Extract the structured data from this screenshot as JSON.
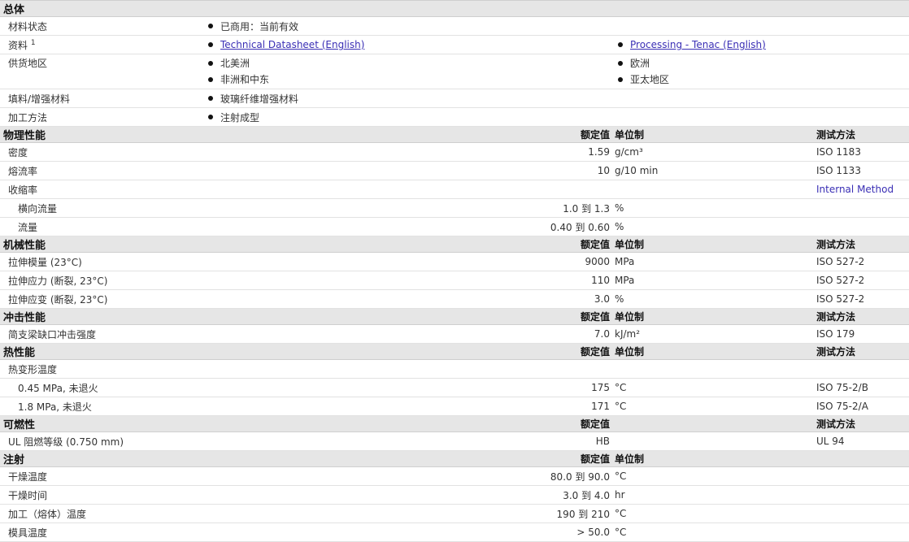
{
  "general": {
    "title": "总体",
    "status": {
      "label": "材料状态",
      "value": "已商用：当前有效"
    },
    "resources": {
      "label": "资料",
      "sup": "1",
      "links": [
        "Technical Datasheet (English)",
        "Processing - Tenac (English)"
      ]
    },
    "regions": {
      "label": "供货地区",
      "col1": [
        "北美洲",
        "非洲和中东"
      ],
      "col2": [
        "欧洲",
        "亚太地区"
      ]
    },
    "filler": {
      "label": "填料/增强材料",
      "value": "玻璃纤维增强材料"
    },
    "method": {
      "label": "加工方法",
      "value": "注射成型"
    }
  },
  "headers": {
    "nominal": "额定值",
    "unit": "单位制",
    "test": "测试方法"
  },
  "physical": {
    "title": "物理性能",
    "rows": [
      {
        "name": "密度",
        "value": "1.59",
        "unit": "g/cm³",
        "method": "ISO 1183"
      },
      {
        "name": "熔流率",
        "value": "10",
        "unit": "g/10 min",
        "method": "ISO 1133"
      },
      {
        "name": "收缩率",
        "value": "",
        "unit": "",
        "method": "Internal Method"
      },
      {
        "name": "横向流量",
        "value": "1.0 到  1.3",
        "unit": "%",
        "method": ""
      },
      {
        "name": "流量",
        "value": "0.40 到  0.60",
        "unit": "%",
        "method": ""
      }
    ]
  },
  "mechanical": {
    "title": "机械性能",
    "rows": [
      {
        "name": "拉伸模量  (23°C)",
        "value": "9000",
        "unit": "MPa",
        "method": "ISO 527-2"
      },
      {
        "name": "拉伸应力  (断裂, 23°C)",
        "value": "110",
        "unit": "MPa",
        "method": "ISO 527-2"
      },
      {
        "name": "拉伸应变  (断裂, 23°C)",
        "value": "3.0",
        "unit": "%",
        "method": "ISO 527-2"
      }
    ]
  },
  "impact": {
    "title": "冲击性能",
    "rows": [
      {
        "name": "简支梁缺口冲击强度",
        "value": "7.0",
        "unit": "kJ/m²",
        "method": "ISO 179"
      }
    ]
  },
  "thermal": {
    "title": "热性能",
    "rows": [
      {
        "name": "热变形温度",
        "value": "",
        "unit": "",
        "method": ""
      },
      {
        "name": "0.45 MPa, 未退火",
        "value": "175",
        "unit": "°C",
        "method": "ISO 75-2/B"
      },
      {
        "name": "1.8 MPa, 未退火",
        "value": "171",
        "unit": "°C",
        "method": "ISO 75-2/A"
      }
    ]
  },
  "flammability": {
    "title": "可燃性",
    "rows": [
      {
        "name": "UL 阻燃等级  (0.750 mm)",
        "value": "HB",
        "unit": "",
        "method": "UL 94"
      }
    ]
  },
  "injection": {
    "title": "注射",
    "rows": [
      {
        "name": "干燥温度",
        "value": "80.0 到  90.0",
        "unit": "°C",
        "method": ""
      },
      {
        "name": "干燥时间",
        "value": "3.0 到  4.0",
        "unit": "hr",
        "method": ""
      },
      {
        "name": "加工（熔体）温度",
        "value": "190 到  210",
        "unit": "°C",
        "method": ""
      },
      {
        "name": "模具温度",
        "value": "> 50.0",
        "unit": "°C",
        "method": ""
      }
    ]
  }
}
